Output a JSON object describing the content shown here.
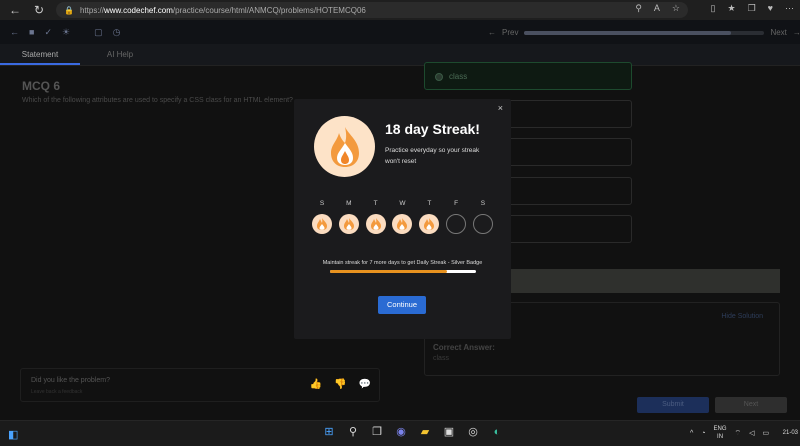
{
  "browser": {
    "url_prefix": "https://",
    "url_host": "www.codechef.com",
    "url_path": "/practice/course/html/ANMCQ/problems/HOTEMCQ06"
  },
  "toolbar": {
    "prev_label": "Prev",
    "next_label": "Next",
    "progress_fraction": 0.86
  },
  "tabs": [
    {
      "label": "Statement"
    },
    {
      "label": "AI Help"
    }
  ],
  "question": {
    "title": "MCQ 6",
    "text": "Which of the following attributes are used to specify a CSS class for an HTML element?"
  },
  "options": [
    {
      "label": "class",
      "selected": true
    },
    {
      "label": ""
    },
    {
      "label": ""
    },
    {
      "label": ""
    },
    {
      "label": ""
    }
  ],
  "feedback": {
    "question": "Did you like the problem?",
    "sub": "Leave back a feedback"
  },
  "solution": {
    "hide_label": "Hide Solution",
    "correct_answer_label": "Correct Answer:",
    "correct_answer_value": "class"
  },
  "actions": {
    "submit_label": "Submit",
    "next_label": "Next"
  },
  "modal": {
    "title": "18 day Streak!",
    "subtitle": "Practice everyday so your streak won't reset",
    "days": [
      {
        "letter": "S",
        "done": true
      },
      {
        "letter": "M",
        "done": true
      },
      {
        "letter": "T",
        "done": true
      },
      {
        "letter": "W",
        "done": true
      },
      {
        "letter": "T",
        "done": true
      },
      {
        "letter": "F",
        "done": false
      },
      {
        "letter": "S",
        "done": false
      }
    ],
    "message": "Maintain streak for 7 more days to get Daily Streak - Silver Badge",
    "progress_fraction": 0.8,
    "continue_label": "Continue",
    "close_symbol": "×"
  },
  "taskbar": {
    "lang_top": "ENG",
    "lang_bottom": "IN",
    "clock": "21-03"
  },
  "colors": {
    "accent": "#2a6bd3",
    "streak_orange": "#e8921f",
    "flame_bg": "#fde3c8"
  }
}
